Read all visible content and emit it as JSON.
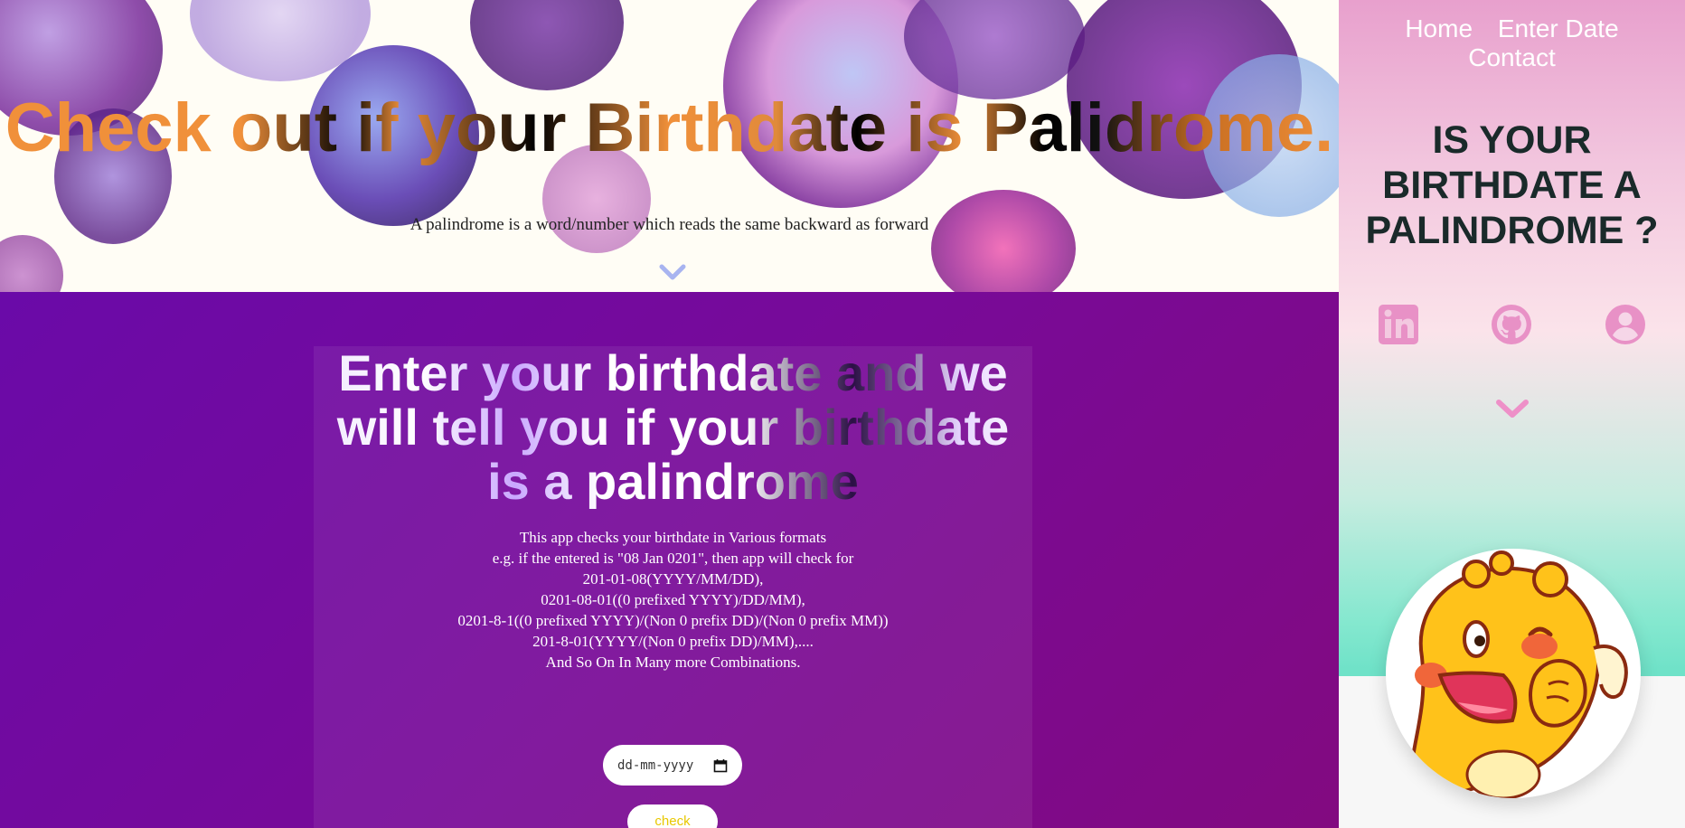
{
  "hero": {
    "title": "Check out if your Birthdate is Palidrome.",
    "subtitle": "A palindrome is a word/number which reads the same backward as forward",
    "scroll_icon": "chevron-down-icon"
  },
  "form": {
    "title": "Enter your birthdate and we will tell you if your birthdate is a palindrome",
    "description": [
      "This app checks your birthdate in Various formats",
      "e.g. if the entered is \"08 Jan 0201\", then app will check for",
      "201-01-08(YYYY/MM/DD),",
      "0201-08-01((0 prefixed YYYY)/DD/MM),",
      "0201-8-1((0 prefixed YYYY)/(Non 0 prefix DD)/(Non 0 prefix MM))",
      "201-8-01(YYYY/(Non 0 prefix DD)/MM),....",
      "And So On In Many more Combinations."
    ],
    "date_placeholder": "dd-mm-yyyy",
    "check_label": "check"
  },
  "sidebar": {
    "nav": {
      "home": "Home",
      "enter_date": "Enter Date",
      "contact": "Contact"
    },
    "title": "IS YOUR BIRTHDATE A PALINDROME ?",
    "social_icons": [
      "linkedin-icon",
      "github-icon",
      "profile-icon"
    ],
    "scroll_icon": "chevron-down-icon",
    "avatar_icon": "cartoon-dinosaur-avatar"
  },
  "colors": {
    "hero_accent": "#f0903a",
    "form_bg": "#780a98",
    "sidebar_icon": "#e891c6",
    "check_text": "#e8c800"
  }
}
